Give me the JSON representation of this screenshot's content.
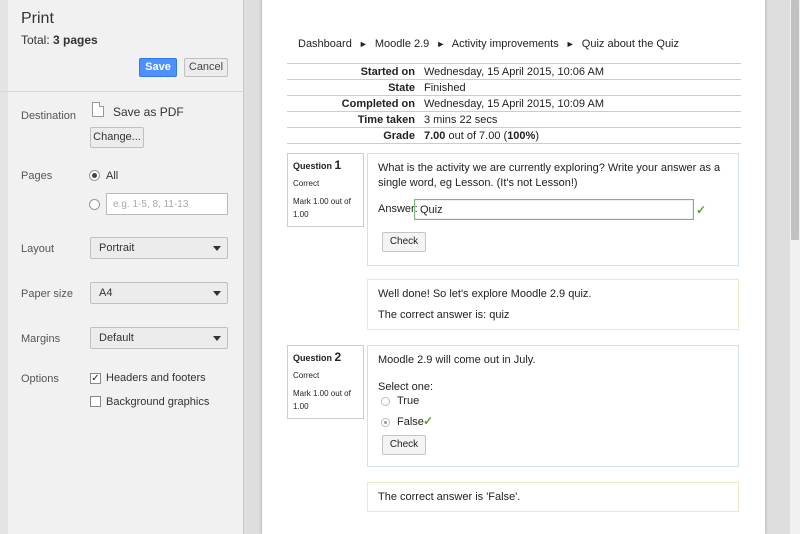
{
  "print_panel": {
    "title": "Print",
    "total_label": "Total: ",
    "total_value": "3 pages",
    "save_label": "Save",
    "cancel_label": "Cancel",
    "destination": {
      "label": "Destination",
      "value": "Save as PDF",
      "change_label": "Change..."
    },
    "pages": {
      "label": "Pages",
      "all_label": "All",
      "range_placeholder": "e.g. 1-5, 8, 11-13"
    },
    "layout": {
      "label": "Layout",
      "value": "Portrait"
    },
    "paper_size": {
      "label": "Paper size",
      "value": "A4"
    },
    "margins": {
      "label": "Margins",
      "value": "Default"
    },
    "options": {
      "label": "Options",
      "headers_footers": {
        "label": "Headers and footers",
        "checked": true
      },
      "background_graphics": {
        "label": "Background graphics",
        "checked": false
      }
    }
  },
  "document": {
    "breadcrumb": [
      "Dashboard",
      "Moodle 2.9",
      "Activity improvements",
      "Quiz about the Quiz"
    ],
    "breadcrumb_sep": "►",
    "summary": [
      {
        "key": "Started on",
        "value": "Wednesday, 15 April 2015, 10:06 AM"
      },
      {
        "key": "State",
        "value": "Finished"
      },
      {
        "key": "Completed on",
        "value": "Wednesday, 15 April 2015, 10:09 AM"
      },
      {
        "key": "Time taken",
        "value": "3 mins 22 secs"
      },
      {
        "key": "Grade",
        "value_bold": "7.00",
        "value_mid": " out of 7.00 (",
        "value_pct": "100%",
        "value_end": ")"
      }
    ],
    "questions": [
      {
        "prefix": "Question ",
        "number": "1",
        "state": "Correct",
        "mark": "Mark 1.00 out of 1.00",
        "text": "What is the activity we are currently exploring? Write your answer as a single word, eg Lesson. (It's not Lesson!)",
        "answer_label": "Answer:",
        "answer_value": "Quiz",
        "check_label": "Check",
        "feedback": "Well done! So let's explore Moodle 2.9 quiz.",
        "correct_answer": "The correct answer is: quiz"
      },
      {
        "prefix": "Question ",
        "number": "2",
        "state": "Correct",
        "mark": "Mark 1.00 out of 1.00",
        "text": "Moodle 2.9 will come out in July.",
        "select_label": "Select one:",
        "options": [
          "True",
          "False"
        ],
        "selected": "False",
        "check_label": "Check",
        "correct_answer": "The correct answer is 'False'."
      }
    ]
  },
  "colors": {
    "save_button": "#4d90fe",
    "tick": "#59a52c",
    "question_border": "#cde4ec",
    "feedback_border": "#ece8c8"
  },
  "icons": {
    "pdf": "file-icon",
    "tick": "check-icon"
  }
}
